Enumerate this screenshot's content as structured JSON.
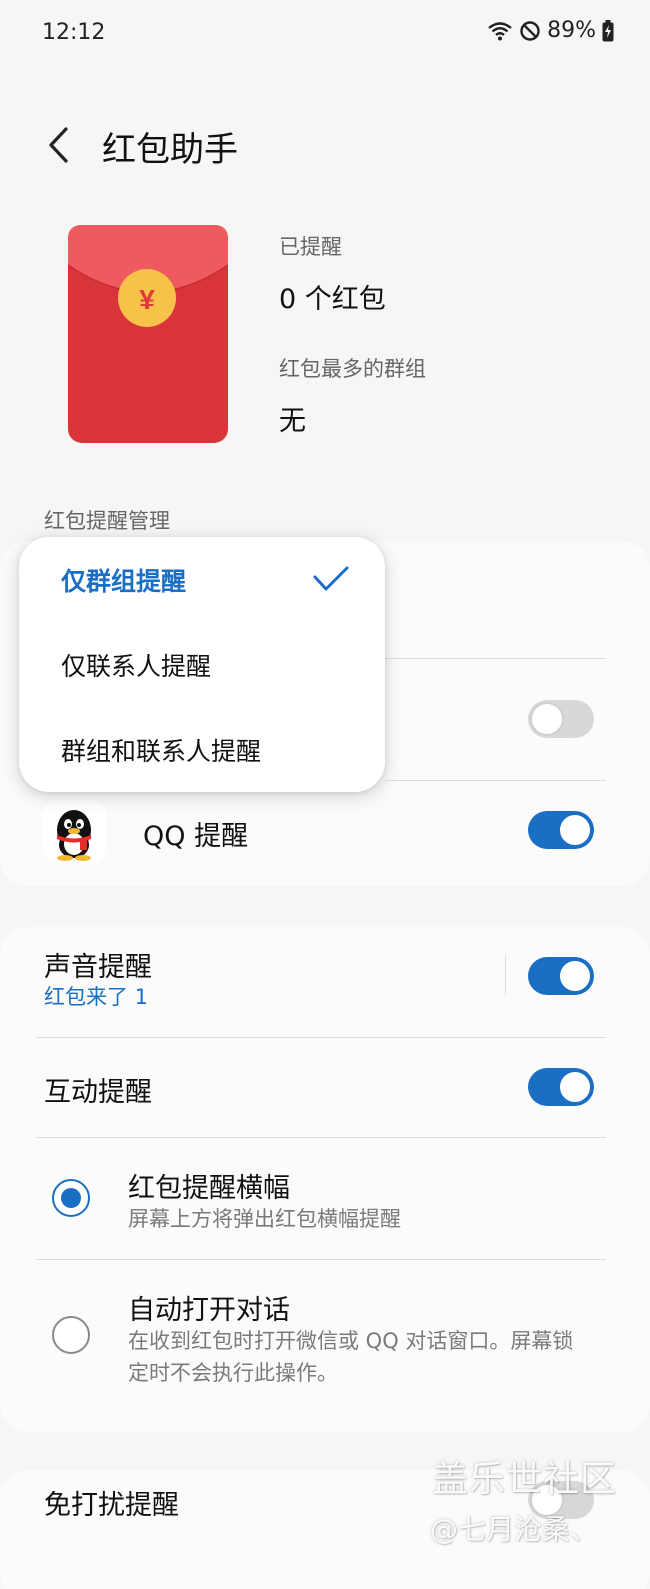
{
  "status_bar": {
    "time": "12:12",
    "battery": "89%",
    "icons": [
      "wifi-icon",
      "do-not-disturb-icon",
      "battery-charging-icon"
    ]
  },
  "header": {
    "title": "红包助手",
    "back_icon": "back-arrow-icon"
  },
  "summary": {
    "reminded_label": "已提醒",
    "reminded_value": "0 个红包",
    "top_group_label": "红包最多的群组",
    "top_group_value": "无",
    "envelope_symbol": "¥"
  },
  "reminder_management": {
    "section_title": "红包提醒管理",
    "qq": {
      "label": "QQ 提醒",
      "enabled": true,
      "icon": "qq-penguin-icon"
    },
    "hidden_row_toggle_enabled": false
  },
  "popup_menu": {
    "items": [
      {
        "label": "仅群组提醒",
        "selected": true
      },
      {
        "label": "仅联系人提醒",
        "selected": false
      },
      {
        "label": "群组和联系人提醒",
        "selected": false
      }
    ]
  },
  "settings": {
    "sound": {
      "label": "声音提醒",
      "sub": "红包来了 1",
      "enabled": true
    },
    "interaction": {
      "label": "互动提醒",
      "enabled": true
    },
    "banner": {
      "label": "红包提醒横幅",
      "sub": "屏幕上方将弹出红包横幅提醒",
      "checked": true
    },
    "auto_open": {
      "label": "自动打开对话",
      "sub_line1": "在收到红包时打开微信或 QQ 对话窗口。屏幕锁",
      "sub_line2": "定时不会执行此操作。",
      "checked": false
    },
    "dnd": {
      "label": "免打扰提醒",
      "enabled": false
    }
  },
  "watermark": {
    "title": "盖乐世社区",
    "author": "@七月沧桑、"
  },
  "colors": {
    "accent": "#1a6fc4",
    "envelope_red": "#e0393e",
    "coin_gold": "#f7c14a",
    "background": "#f6f6f6"
  }
}
